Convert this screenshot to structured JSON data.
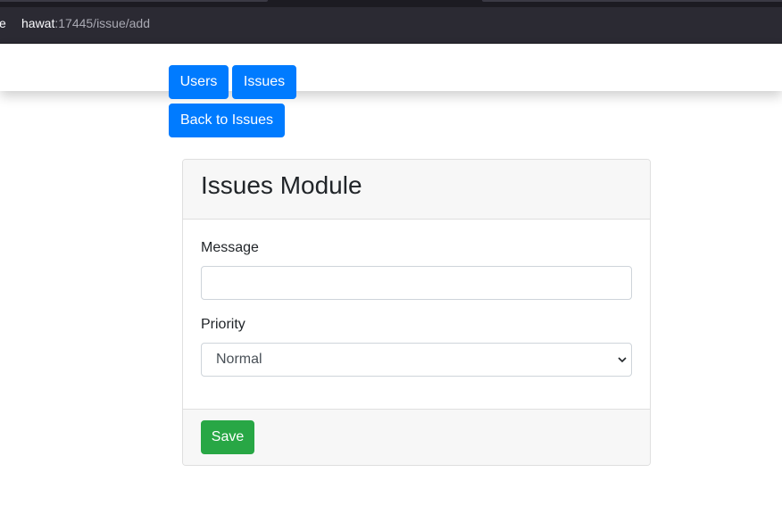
{
  "browser": {
    "leading_char": "e",
    "url_host": "hawat",
    "url_rest": ":17445/issue/add"
  },
  "nav": {
    "users_label": "Users",
    "issues_label": "Issues",
    "back_label": "Back to Issues"
  },
  "card": {
    "title": "Issues Module",
    "message_label": "Message",
    "message_value": "",
    "priority_label": "Priority",
    "priority_value": "Normal",
    "save_label": "Save"
  },
  "colors": {
    "primary": "#007bff",
    "success": "#28a745",
    "chrome_dark": "#2b2a33"
  },
  "icons": {
    "select_chevron": "chevron-down-icon"
  }
}
